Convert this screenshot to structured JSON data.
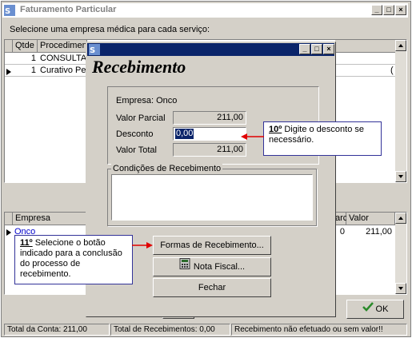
{
  "main_window": {
    "title": "Faturamento Particular",
    "instruction": "Selecione uma empresa médica para cada serviço:",
    "services_table": {
      "headers": [
        "Qtde",
        "Procediment"
      ],
      "rows": [
        {
          "qtde": "1",
          "procedimento": "CONSULTA"
        },
        {
          "qtde": "1",
          "procedimento": "Curativo Peq"
        }
      ],
      "partial_cell": "("
    },
    "company_table": {
      "headers": [
        "Empresa",
        "arc.",
        "Valor"
      ],
      "row": {
        "empresa": "Onco",
        "parc": "0",
        "valor": "211,00"
      }
    },
    "ok_button": "OK",
    "status_bar": {
      "total_conta": "Total da Conta: 211,00",
      "total_recebimentos": "Total de Recebimentos: 0,00",
      "message": "Recebimento não efetuado ou sem valor!!"
    }
  },
  "dialog": {
    "heading": "Recebimento",
    "empresa_label": "Empresa: Onco",
    "valor_parcial_label": "Valor Parcial",
    "valor_parcial_value": "211,00",
    "desconto_label": "Desconto",
    "desconto_value": "0,00",
    "valor_total_label": "Valor Total",
    "valor_total_value": "211,00",
    "condicoes_label": "Condições de Recebimento",
    "formas_button": "Formas de Recebimento...",
    "nota_fiscal_button": "Nota Fiscal...",
    "fechar_button": "Fechar"
  },
  "annotations": {
    "step10_number": "10º",
    "step10_text": " Digite o desconto se necessário.",
    "step11_number": "11º",
    "step11_text": " Selecione o botão indicado para a conclusão do processo de recebimento."
  },
  "colors": {
    "window_face": "#d4d0c8",
    "active_title": "#0a246a",
    "annotation_arrow": "#e00000",
    "ok_check": "#2a8a2a"
  }
}
